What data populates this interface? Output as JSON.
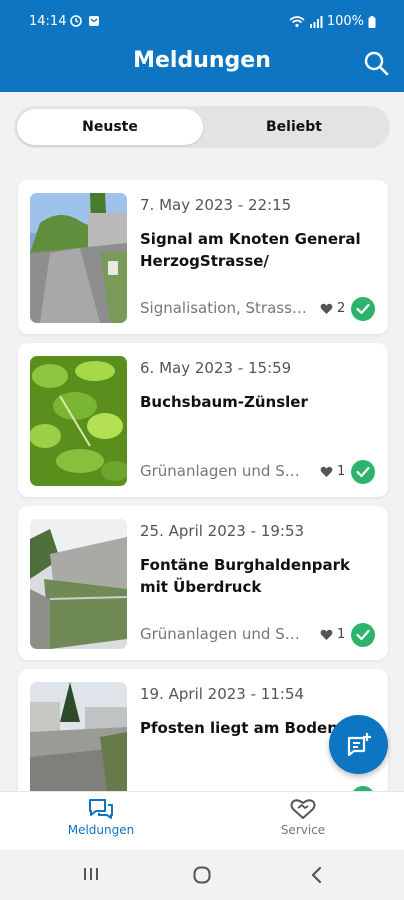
{
  "status_bar": {
    "time": "14:14",
    "battery": "100%"
  },
  "app_bar": {
    "title": "Meldungen"
  },
  "tabs": {
    "active": "Neuste",
    "inactive": "Beliebt"
  },
  "reports": [
    {
      "date": "7. May 2023 - 22:15",
      "title": "Signal am Knoten General HerzogStrasse/",
      "category": "Signalisation, Strassenbeleuchtung",
      "likes": "2"
    },
    {
      "date": "6. May 2023 - 15:59",
      "title": "Buchsbaum-Zünsler",
      "category": "Grünanlagen und Spielplätze",
      "likes": "1"
    },
    {
      "date": "25. April 2023 - 19:53",
      "title": "Fontäne Burghaldenpark mit Überdruck",
      "category": "Grünanlagen und Spielplätze",
      "likes": "1"
    },
    {
      "date": "19. April 2023 - 11:54",
      "title": "Pfosten liegt am Boden",
      "category": "",
      "likes": ""
    }
  ],
  "bottom_nav": {
    "reports_label": "Meldungen",
    "service_label": "Service"
  },
  "colors": {
    "brand": "#0e75c2",
    "status_ok": "#2db36b"
  }
}
